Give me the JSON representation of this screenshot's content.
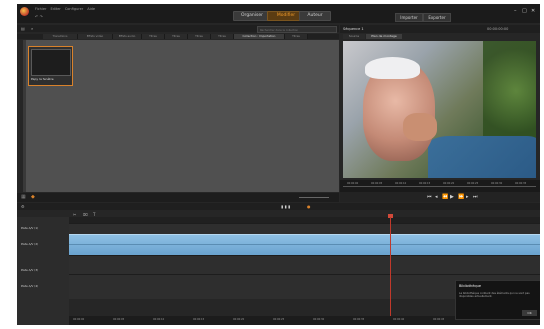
{
  "titlebar": {
    "menu": [
      "Fichier",
      "Editer",
      "Configurer",
      "Aide"
    ],
    "tabs": [
      "Organiser",
      "Modifier",
      "Auteur"
    ],
    "active_tab": "Modifier",
    "right_buttons": [
      "Importer",
      "Exporter"
    ],
    "window_controls": [
      "minimize-icon",
      "maximize-icon",
      "close-icon"
    ]
  },
  "library": {
    "tabs": [
      "Transitions",
      "Effets vidéo",
      "Effets audio",
      "Titres",
      "Titres",
      "Titres",
      "Titres",
      "Collection : Importation",
      "Titres"
    ],
    "active_tab": "Collection : Importation",
    "thumb_label": "Papy la fenêtre",
    "search_placeholder": "Rechercher dans la collection"
  },
  "player": {
    "header_title": "Séquence 1",
    "timecode": "00:00:00:00",
    "tabs": [
      "Source",
      "Plan de montage"
    ],
    "active_tab": "Plan de montage",
    "scrub_marks": [
      "00:00:00",
      "00:00:05",
      "00:00:10",
      "00:00:15",
      "00:00:20",
      "00:00:25",
      "00:00:30",
      "00:00:35"
    ],
    "transport_icons": [
      "skip-start-icon",
      "prev-frame-icon",
      "rewind-icon",
      "play-icon",
      "forward-icon",
      "next-frame-icon",
      "skip-end-icon"
    ]
  },
  "timeline": {
    "tracks": [
      "Piste A/V (1)",
      "Piste A/V (2)",
      "Piste A/V (3)",
      "Piste A/V (4)"
    ],
    "time_marks": [
      "00:00:00",
      "00:00:05",
      "00:00:10",
      "00:00:15",
      "00:00:20",
      "00:00:25",
      "00:00:30",
      "00:00:35",
      "00:00:40",
      "00:00:45",
      "00:00:50",
      "00:00:55"
    ]
  },
  "notice": {
    "title": "Bibliothèque",
    "body": "La bibliothèque contient des éléments qui ne sont pas disponibles actuellement.",
    "button": "OK"
  }
}
